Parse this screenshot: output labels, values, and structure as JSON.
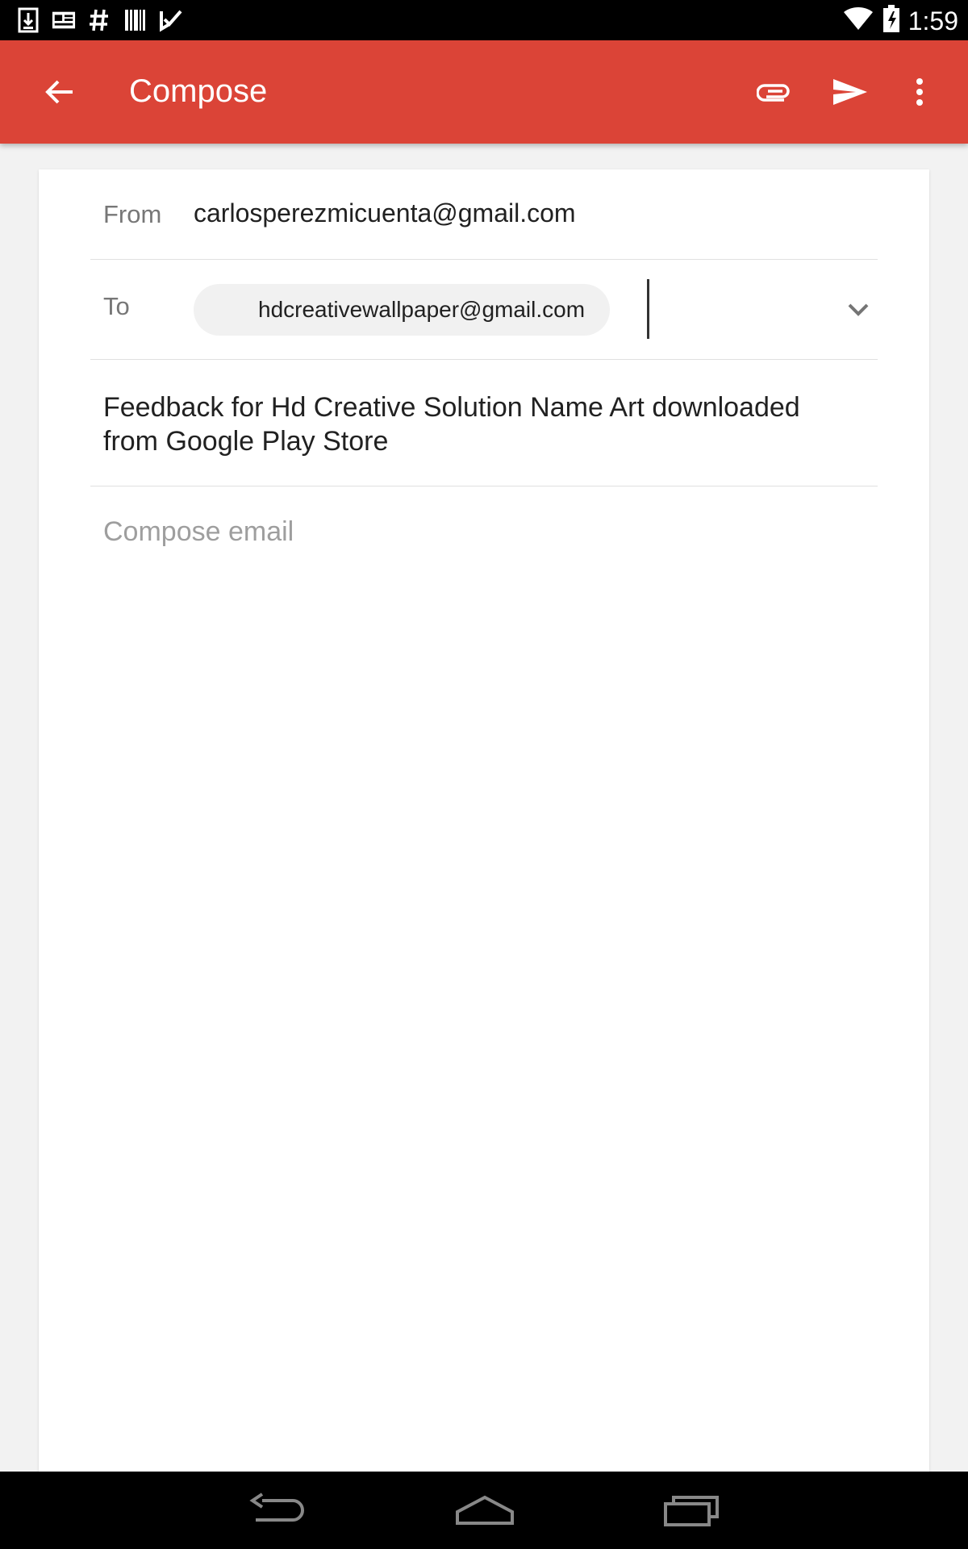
{
  "status_bar": {
    "time": "1:59",
    "notification_icons": [
      "download-icon",
      "news-icon",
      "hashtag-icon",
      "barcode-icon",
      "task-check-icon"
    ],
    "system_icons": [
      "wifi-icon",
      "battery-icon"
    ]
  },
  "app_bar": {
    "title": "Compose",
    "color": "#db4437",
    "actions": [
      "attach-icon",
      "send-icon",
      "overflow-menu-icon"
    ]
  },
  "form": {
    "from_label": "From",
    "from_value": "carlosperezmicuenta@gmail.com",
    "to_label": "To",
    "to_recipient": "hdcreativewallpaper@gmail.com",
    "subject": "Feedback for Hd Creative Solution Name Art downloaded from Google Play Store",
    "body_placeholder": "Compose email"
  },
  "nav_bar": {
    "buttons": [
      "back-icon",
      "home-icon",
      "recents-icon"
    ]
  }
}
